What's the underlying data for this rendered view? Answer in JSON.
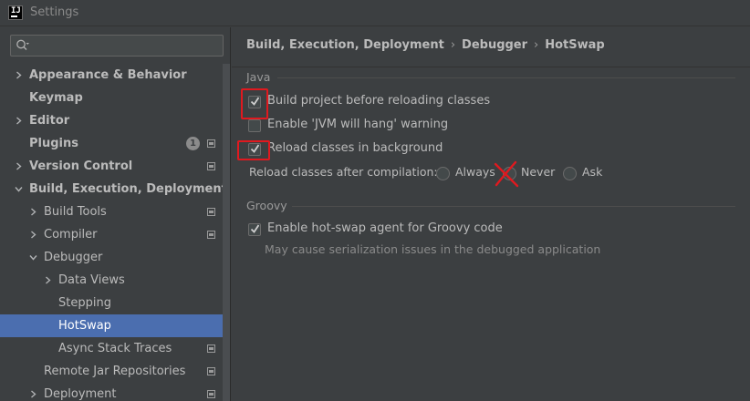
{
  "window": {
    "title": "Settings"
  },
  "search": {
    "placeholder": "",
    "value": ""
  },
  "sidebar": {
    "items": [
      {
        "label": "Appearance & Behavior",
        "bold": true
      },
      {
        "label": "Keymap",
        "bold": true
      },
      {
        "label": "Editor",
        "bold": true
      },
      {
        "label": "Plugins",
        "bold": true,
        "badge": "1"
      },
      {
        "label": "Version Control",
        "bold": true
      },
      {
        "label": "Build, Execution, Deployment",
        "bold": true
      },
      {
        "label": "Build Tools"
      },
      {
        "label": "Compiler"
      },
      {
        "label": "Debugger"
      },
      {
        "label": "Data Views"
      },
      {
        "label": "Stepping"
      },
      {
        "label": "HotSwap",
        "selected": true
      },
      {
        "label": "Async Stack Traces"
      },
      {
        "label": "Remote Jar Repositories"
      },
      {
        "label": "Deployment"
      }
    ]
  },
  "breadcrumb": [
    "Build, Execution, Deployment",
    "Debugger",
    "HotSwap"
  ],
  "java": {
    "title": "Java",
    "build_before_reload": {
      "label": "Build project before reloading classes",
      "checked": true
    },
    "jvm_hang_warning": {
      "label": "Enable 'JVM will hang' warning",
      "checked": false
    },
    "reload_in_background": {
      "label": "Reload classes in background",
      "checked": true
    },
    "reload_after_compilation": {
      "label": "Reload classes after compilation:",
      "options": [
        "Always",
        "Never",
        "Ask"
      ],
      "selected": "Never"
    }
  },
  "groovy": {
    "title": "Groovy",
    "hotswap_agent": {
      "label": "Enable hot-swap agent for Groovy code",
      "checked": true
    },
    "hint": "May cause serialization issues in the debugged application"
  },
  "colors": {
    "accent_selection": "#4b6eaf",
    "annotation_red": "#e0191f",
    "background": "#3c3f41"
  }
}
